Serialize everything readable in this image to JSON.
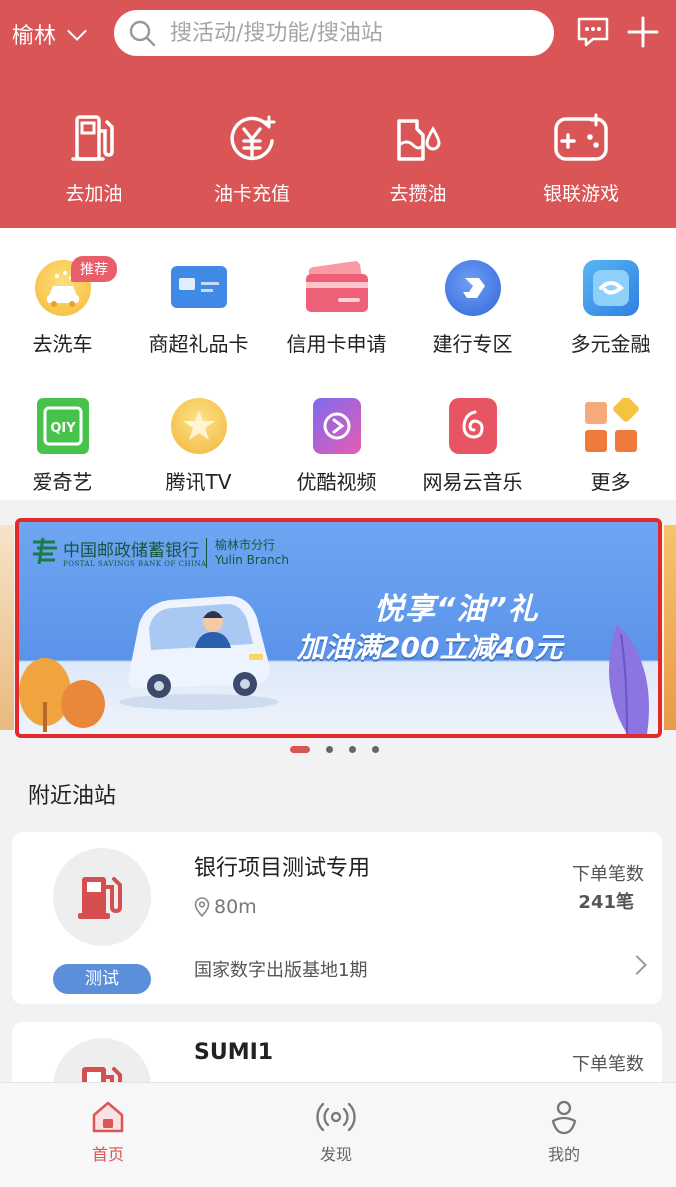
{
  "header": {
    "city": "榆林",
    "search_placeholder": "搜活动/搜功能/搜油站",
    "main_nav": [
      {
        "label": "去加油",
        "icon": "gas-pump-icon"
      },
      {
        "label": "油卡充值",
        "icon": "yuan-recharge-icon"
      },
      {
        "label": "去攒油",
        "icon": "oil-collect-icon"
      },
      {
        "label": "银联游戏",
        "icon": "gamepad-icon"
      }
    ]
  },
  "services": [
    {
      "label": "去洗车",
      "badge": "推荐",
      "icon": "car-wash-icon"
    },
    {
      "label": "商超礼品卡",
      "icon": "gift-card-icon"
    },
    {
      "label": "信用卡申请",
      "icon": "credit-card-icon"
    },
    {
      "label": "建行专区",
      "icon": "ccb-icon"
    },
    {
      "label": "多元金融",
      "icon": "finance-icon"
    },
    {
      "label": "爱奇艺",
      "icon": "iqiyi-icon"
    },
    {
      "label": "腾讯TV",
      "icon": "tencent-video-icon"
    },
    {
      "label": "优酷视频",
      "icon": "youku-icon"
    },
    {
      "label": "网易云音乐",
      "icon": "netease-music-icon"
    },
    {
      "label": "更多",
      "icon": "more-grid-icon"
    }
  ],
  "banner": {
    "bank_name": "中国邮政储蓄银行",
    "bank_name_en": "POSTAL SAVINGS BANK OF CHINA",
    "branch_cn": "榆林市分行",
    "branch_en": "Yulin Branch",
    "promo_title": "悦享“油”礼",
    "promo_text": "加油满200立减40元",
    "slides_total": 4,
    "slide_active": 1
  },
  "nearby": {
    "title": "附近油站",
    "stations": [
      {
        "name": "银行项目测试专用",
        "tag": "测试",
        "distance": "80m",
        "address": "国家数字出版基地1期",
        "orders_label": "下单笔数",
        "orders_count": "241笔"
      },
      {
        "name": "SUMI1",
        "orders_label": "下单笔数"
      }
    ]
  },
  "tabbar": {
    "tabs": [
      {
        "label": "首页",
        "active": true
      },
      {
        "label": "发现",
        "active": false
      },
      {
        "label": "我的",
        "active": false
      }
    ]
  },
  "colors": {
    "brand_red": "#d95556",
    "tag_blue": "#5b8fd9",
    "banner_border": "#e32a2a"
  }
}
